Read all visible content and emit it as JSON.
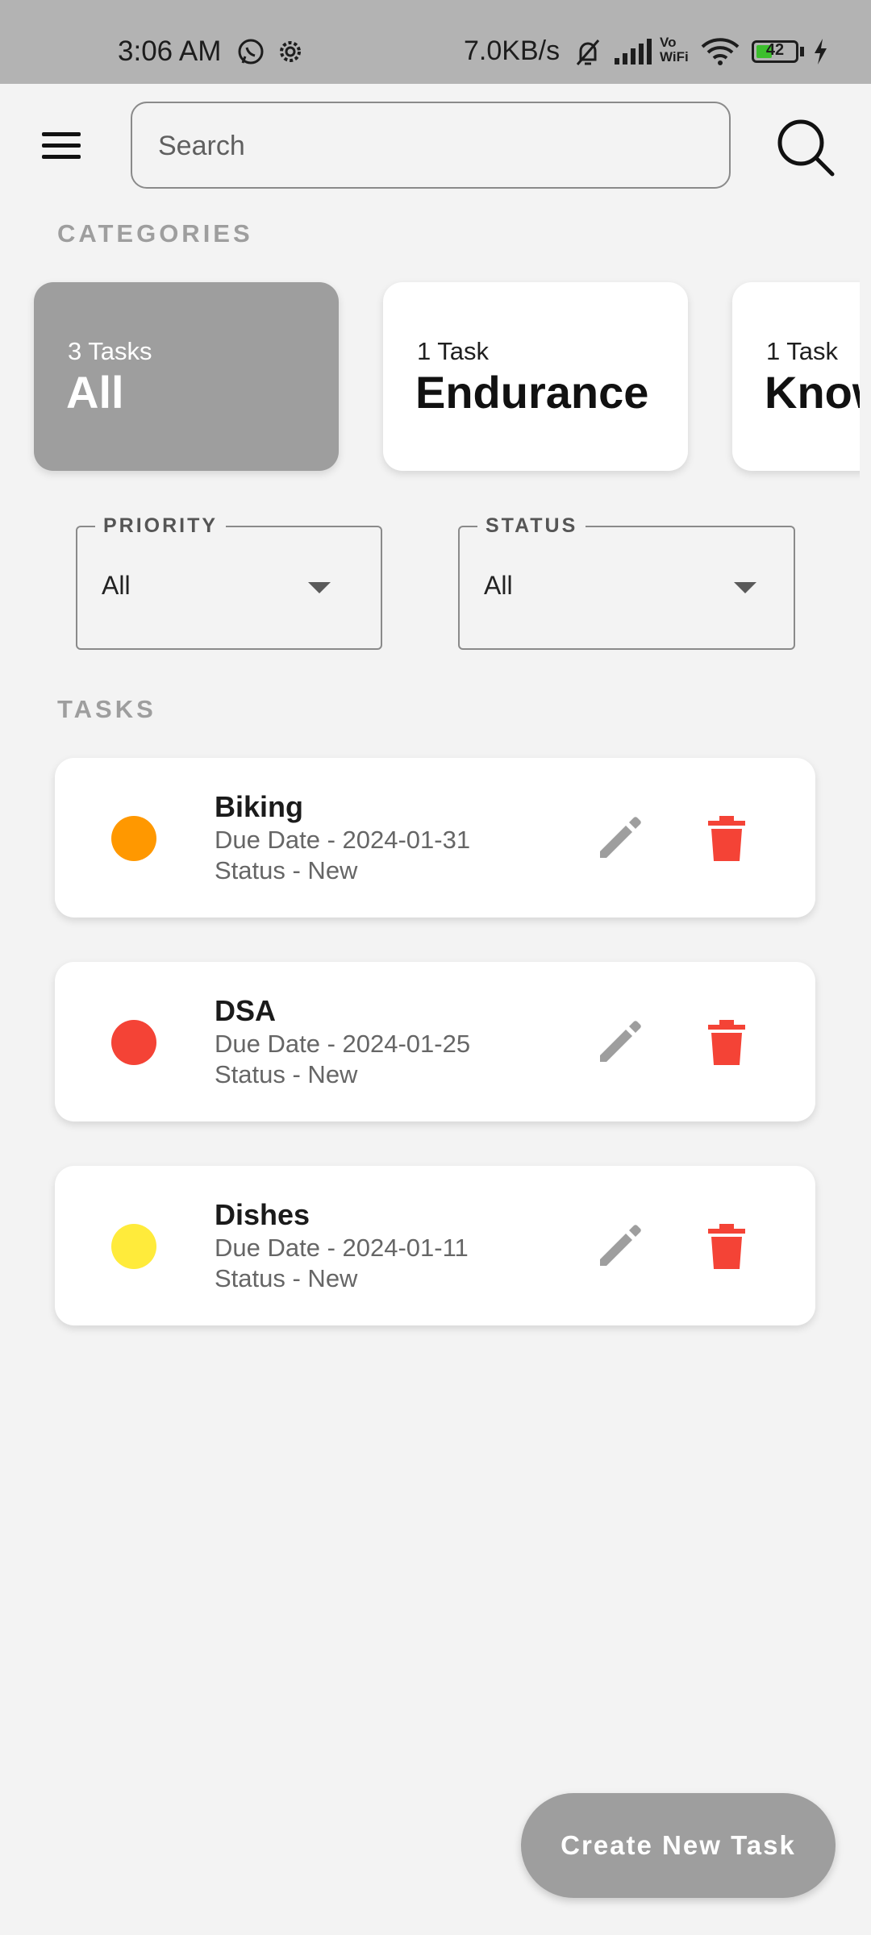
{
  "status_bar": {
    "time": "3:06 AM",
    "network_speed": "7.0KB/s",
    "battery": "42",
    "battery_level": 0.42,
    "icons": [
      "whatsapp-icon",
      "settings-icon",
      "bell-off-icon",
      "signal-icon",
      "vowifi-icon",
      "wifi-icon",
      "battery-icon",
      "charging-icon"
    ]
  },
  "header": {
    "search_placeholder": "Search",
    "icons": [
      "menu-icon",
      "search-icon"
    ]
  },
  "categories": {
    "label": "CATEGORIES",
    "items": [
      {
        "count": "3 Tasks",
        "name": "All",
        "active": true
      },
      {
        "count": "1 Task",
        "name": "Endurance",
        "active": false
      },
      {
        "count": "1 Task",
        "name": "Knowledge",
        "active": false
      }
    ]
  },
  "filters": {
    "priority": {
      "label": "PRIORITY",
      "value": "All"
    },
    "status": {
      "label": "STATUS",
      "value": "All"
    }
  },
  "tasks": {
    "label": "TASKS",
    "items": [
      {
        "title": "Biking",
        "due": "Due Date - 2024-01-31",
        "status": "Status - New",
        "color": "#ff9800"
      },
      {
        "title": "DSA",
        "due": "Due Date - 2024-01-25",
        "status": "Status - New",
        "color": "#f44336"
      },
      {
        "title": "Dishes",
        "due": "Due Date - 2024-01-11",
        "status": "Status - New",
        "color": "#ffeb3b"
      }
    ]
  },
  "fab": {
    "label": "Create New Task"
  },
  "colors": {
    "accent_gray": "#9e9e9e",
    "delete_red": "#f44336",
    "edit_gray": "#9e9e9e",
    "background": "#f3f3f3"
  }
}
